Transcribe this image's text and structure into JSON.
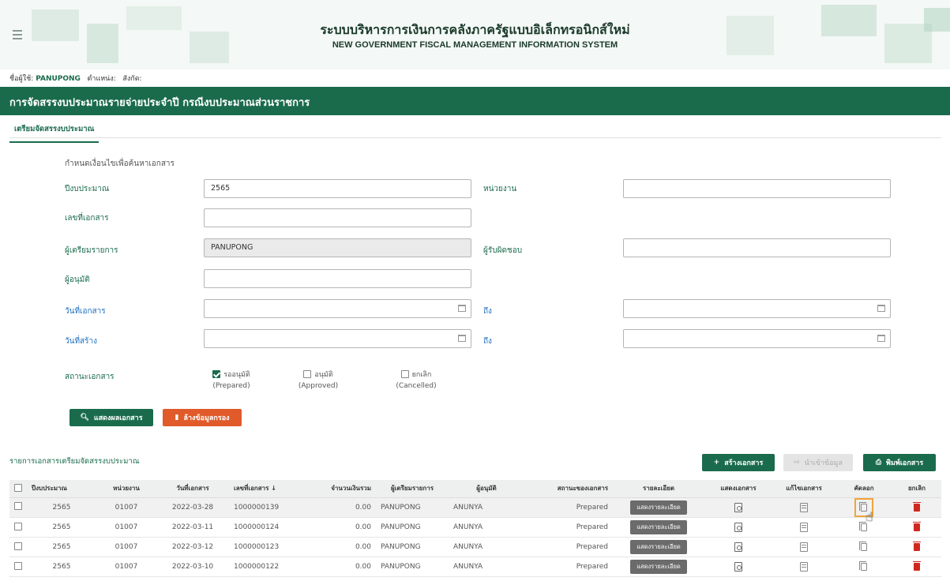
{
  "header": {
    "title_th": "ระบบบริหารการเงินการคลังภาครัฐแบบอิเล็กทรอนิกส์ใหม่",
    "title_en": "NEW GOVERNMENT FISCAL MANAGEMENT INFORMATION SYSTEM"
  },
  "user": {
    "name_label": "ชื่อผู้ใช้:",
    "name": "PANUPONG",
    "position_label": "ตำแหน่ง:",
    "affiliation_label": "สังกัด:"
  },
  "page_title": "การจัดสรรงบประมาณรายจ่ายประจำปี กรณีงบประมาณส่วนราชการ",
  "tab": "เตรียมจัดสรรงบประมาณ",
  "search": {
    "section_title": "กำหนดเงื่อนไขเพื่อค้นหาเอกสาร",
    "fiscal_year_label": "ปีงบประมาณ",
    "fiscal_year_value": "2565",
    "agency_label": "หน่วยงาน",
    "doc_no_label": "เลขที่เอกสาร",
    "preparer_label": "ผู้เตรียมรายการ",
    "preparer_value": "PANUPONG",
    "responsible_label": "ผู้รับผิดชอบ",
    "approver_label": "ผู้อนุมัติ",
    "doc_date_label": "วันที่เอกสาร",
    "to_label": "ถึง",
    "created_date_label": "วันที่สร้าง",
    "status_label": "สถานะเอกสาร",
    "statuses": [
      {
        "th": "รออนุมัติ",
        "en": "(Prepared)",
        "checked": true
      },
      {
        "th": "อนุมัติ",
        "en": "(Approved)",
        "checked": false
      },
      {
        "th": "ยกเลิก",
        "en": "(Cancelled)",
        "checked": false
      }
    ],
    "show_button": "แสดงผลเอกสาร",
    "clear_button": "ล้างข้อมูลกรอง"
  },
  "list": {
    "title": "รายการเอกสารเตรียมจัดสรรงบประมาณ",
    "create_button": "สร้างเอกสาร",
    "import_button": "นำเข้าข้อมูล",
    "print_button": "พิมพ์เอกสาร",
    "columns": [
      "ปีงบประมาณ",
      "หน่วยงาน",
      "วันที่เอกสาร",
      "เลขที่เอกสาร ↓",
      "จำนวนเงินรวม",
      "ผู้เตรียมรายการ",
      "ผู้อนุมัติ",
      "สถานะของเอกสาร",
      "รายละเอียด",
      "แสดงเอกสาร",
      "แก้ไขเอกสาร",
      "คัดลอก",
      "ยกเลิก"
    ],
    "detail_label": "แสดงรายละเอียด",
    "rows": [
      {
        "year": "2565",
        "agency": "01007",
        "date": "2022-03-28",
        "doc_no": "1000000139",
        "amount": "0.00",
        "preparer": "PANUPONG",
        "approver": "ANUNYA",
        "status": "Prepared"
      },
      {
        "year": "2565",
        "agency": "01007",
        "date": "2022-03-11",
        "doc_no": "1000000124",
        "amount": "0.00",
        "preparer": "PANUPONG",
        "approver": "ANUNYA",
        "status": "Prepared"
      },
      {
        "year": "2565",
        "agency": "01007",
        "date": "2022-03-12",
        "doc_no": "1000000123",
        "amount": "0.00",
        "preparer": "PANUPONG",
        "approver": "ANUNYA",
        "status": "Prepared"
      },
      {
        "year": "2565",
        "agency": "01007",
        "date": "2022-03-10",
        "doc_no": "1000000122",
        "amount": "0.00",
        "preparer": "PANUPONG",
        "approver": "ANUNYA",
        "status": "Prepared"
      }
    ]
  }
}
